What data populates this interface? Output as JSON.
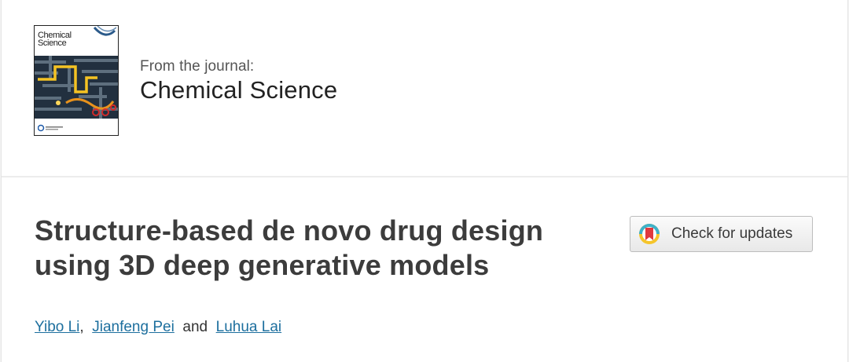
{
  "journal": {
    "cover_title_line1": "Chemical",
    "cover_title_line2": "Science",
    "from_label": "From the journal:",
    "name": "Chemical Science"
  },
  "article": {
    "title_line1": "Structure-based de novo drug design",
    "title_line2": "using 3D deep generative models",
    "check_updates_label": "Check for updates"
  },
  "authors": [
    {
      "name": "Yibo Li"
    },
    {
      "name": "Jianfeng Pei"
    },
    {
      "name": "Luhua Lai"
    }
  ],
  "author_separators": {
    "comma": ",",
    "and": "and"
  },
  "colors": {
    "link": "#1d6f9e",
    "title": "#3c3c3c"
  },
  "icons": {
    "check_updates": "crossmark-icon"
  }
}
